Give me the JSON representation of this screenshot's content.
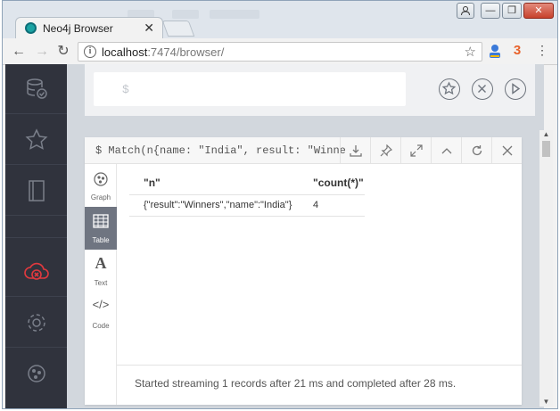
{
  "browser": {
    "tab_title": "Neo4j Browser",
    "tab_close": "✕",
    "url_host": "localhost",
    "url_path": ":7474/browser/",
    "info_glyph": "i",
    "window_buttons": [
      "—",
      "❐",
      "✕"
    ]
  },
  "sidebar": {
    "items": [
      {
        "icon": "database-icon"
      },
      {
        "icon": "star-icon"
      },
      {
        "icon": "book-icon"
      },
      {
        "icon": "cloud-disconnected-icon"
      },
      {
        "icon": "gear-icon"
      },
      {
        "icon": "neo4j-logo-icon"
      }
    ]
  },
  "editor": {
    "prompt": "$"
  },
  "frame": {
    "command": "$ Match(n{name: \"India\", result: \"Winners…",
    "tabs": [
      {
        "label": "Graph",
        "icon": "graph-icon"
      },
      {
        "label": "Table",
        "icon": "table-icon"
      },
      {
        "label": "Text",
        "icon": "text-icon",
        "glyph": "A"
      },
      {
        "label": "Code",
        "icon": "code-icon",
        "glyph": "</>"
      }
    ],
    "table": {
      "headers": [
        "\"n\"",
        "\"count(*)\""
      ],
      "rows": [
        [
          "{\"result\":\"Winners\",\"name\":\"India\"}",
          "4"
        ]
      ]
    },
    "status": "Started streaming 1 records after 21 ms and completed after 28 ms."
  },
  "colors": {
    "sidebar_bg": "#30333d",
    "active_tab": "#6f7581",
    "disconnect_red": "#e0393e"
  }
}
